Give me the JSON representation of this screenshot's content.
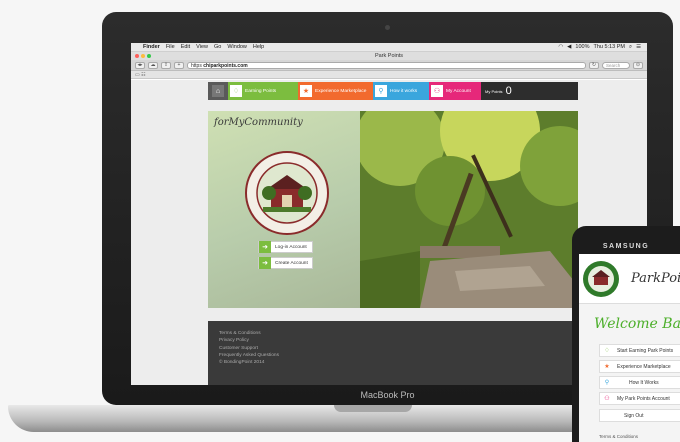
{
  "menubar": {
    "items": [
      "Finder",
      "File",
      "Edit",
      "View",
      "Go",
      "Window",
      "Help"
    ],
    "battery": "100%",
    "clock": "Thu 5:13 PM"
  },
  "browser": {
    "window_title": "Park Points",
    "url_scheme": "https",
    "url_host": "chiparkpoints.com",
    "search_placeholder": "Search"
  },
  "site": {
    "nav": [
      {
        "label": "Earning Points",
        "color": "#7cbd3f",
        "icon": "lightbulb-icon"
      },
      {
        "label": "Experience Marketplace",
        "color": "#f26a2e",
        "icon": "star-icon"
      },
      {
        "label": "How it works",
        "color": "#3aa6dd",
        "icon": "search-icon"
      },
      {
        "label": "My Account",
        "color": "#e6287a",
        "icon": "people-icon"
      }
    ],
    "points_label": "My Points",
    "points_value": "0",
    "hero": {
      "tagline": "forMyCommunity",
      "login": "Log-in Account",
      "create": "Create Account"
    },
    "footer": [
      "Terms & Conditions",
      "Privacy Policy",
      "Customer Support",
      "Frequently Asked Questions",
      "© BondingPoint 2014"
    ]
  },
  "laptop": {
    "brand": "MacBook Pro"
  },
  "phone": {
    "brand": "SAMSUNG",
    "app_title": "ParkPoints",
    "welcome": "Welcome Back",
    "buttons": [
      {
        "label": "Start Earning Park Points",
        "icon": "lightbulb-icon",
        "color": "#7cbd3f"
      },
      {
        "label": "Experience Marketplace",
        "icon": "star-icon",
        "color": "#f26a2e"
      },
      {
        "label": "How It Works",
        "icon": "search-icon",
        "color": "#3aa6dd"
      },
      {
        "label": "My Park Points Account",
        "icon": "people-icon",
        "color": "#e6287a"
      },
      {
        "label": "Sign Out",
        "icon": "",
        "color": ""
      }
    ],
    "footer": "Terms & Conditions"
  }
}
